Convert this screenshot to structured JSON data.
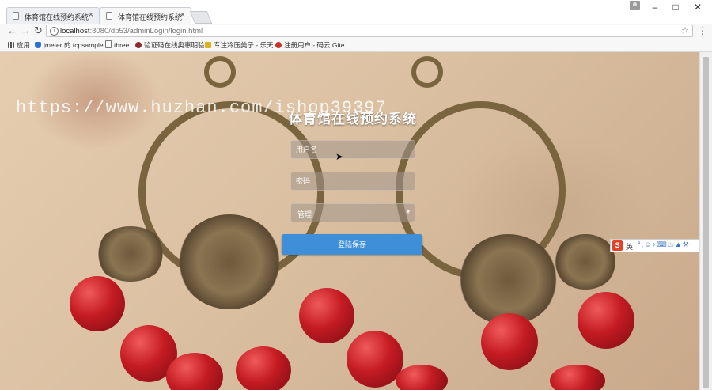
{
  "browser": {
    "tabs": [
      {
        "title": "体育馆在线预约系统",
        "active": false
      },
      {
        "title": "体育馆在线预约系统",
        "active": true
      }
    ],
    "close_glyph": "×",
    "url_host": "localhost",
    "url_path": ":8080/dp53/adminLogin/login.html",
    "bookmarks": [
      {
        "label": "应用",
        "icon": "apps-grid-icon",
        "color": "#555555"
      },
      {
        "label": "jmeter 的 tcpsample",
        "icon": "shield-icon",
        "color": "#2a6fd6"
      },
      {
        "label": "three",
        "icon": "page-icon",
        "color": "#777777"
      },
      {
        "label": "验证码在线奥惠明验",
        "icon": "bug-icon",
        "color": "#8a2a2a"
      },
      {
        "label": "专注冷压美子 - 乐天",
        "icon": "folder-icon",
        "color": "#e0b020"
      },
      {
        "label": "注册用户 - 码云 Gite",
        "icon": "gitee-icon",
        "color": "#c7322b"
      }
    ]
  },
  "watermark": "https://www.huzhan.com/ishop39397",
  "login": {
    "title": "体育馆在线预约系统",
    "username_placeholder": "用户名",
    "password_placeholder": "密码",
    "role_value": "管理",
    "submit_label": "登陆保存"
  },
  "ime": {
    "label": "英"
  },
  "colors": {
    "button": "#3e8ed8",
    "bead_red": "#c41b23"
  }
}
